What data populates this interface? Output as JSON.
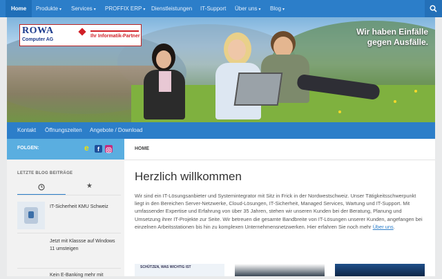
{
  "topnav": {
    "items": [
      {
        "label": "Home",
        "caret": ""
      },
      {
        "label": "Produkte",
        "caret": "▾"
      },
      {
        "label": "Services",
        "caret": "▾"
      },
      {
        "label": "PROFFIX ERP",
        "caret": "▾"
      },
      {
        "label": "Dienstleistungen",
        "caret": ""
      },
      {
        "label": "IT-Support",
        "caret": ""
      },
      {
        "label": "Über uns",
        "caret": "▾"
      },
      {
        "label": "Blog",
        "caret": "▾"
      }
    ],
    "search_icon": "search-icon"
  },
  "banner": {
    "logo_name": "ROWA",
    "logo_company": "Computer AG",
    "logo_tagline": "Ihr Informatik-Partner",
    "slogan_line1": "Wir haben Einfälle",
    "slogan_line2": "gegen Ausfälle."
  },
  "subnav": {
    "items": [
      "Kontakt",
      "Öffnungszeiten",
      "Angebote / Download"
    ]
  },
  "follow": {
    "label": "FOLGEN:",
    "icons": [
      "edge-icon",
      "facebook-icon",
      "instagram-icon"
    ]
  },
  "breadcrumb": {
    "label": "HOME"
  },
  "sidebar": {
    "heading": "LETZTE BLOG BEITRÄGE",
    "tabs": [
      "clock-icon",
      "star-icon"
    ],
    "posts": [
      {
        "title": "IT-Sicherheit KMU Schweiz"
      },
      {
        "title": "Jetzt mit Klassse auf Windows 11 umsteigen"
      },
      {
        "title": "Kein E-Banking mehr mit"
      }
    ]
  },
  "main": {
    "title": "Herzlich willkommen",
    "paragraph": "Wir sind ein IT-Lösungsanbieter und Systemintegrator mit Sitz in Frick in der Nordwestschweiz. Unser Tätigkeitsschwerpunkt liegt in den Bereichen Server-Netzwerke, Cloud-Lösungen, IT-Sicherheit, Managed Services, Wartung und IT-Support. Mit umfassender Expertise und Erfahrung von über 35 Jahren, stehen wir unseren Kunden bei der Beratung, Planung und Umsetzung ihrer IT-Projekte zur Seite. Wir betreuen die gesamte Bandbreite von IT-Lösungen unserer Kunden, angefangen bei einzelnen Arbeitsstationen bis hin zu komplexen Unternehmensnetzwerken. Hier erfahren Sie noch mehr",
    "more_link": "Über uns",
    "thumb1_text": "SCHÜTZEN, WAS WICHTIG IST"
  },
  "colors": {
    "primary": "#2c7ec9",
    "follow": "#5aaee0"
  }
}
